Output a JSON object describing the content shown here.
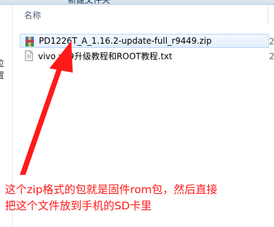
{
  "toolbar": {
    "fragment_left": "",
    "fragment_right": "新建文件夹"
  },
  "left_pane": {
    "partial_label": "位置"
  },
  "columns": {
    "name_label": "名称"
  },
  "files": [
    {
      "name": "PD1226T_A_1.16.2-update-full_r9449.zip",
      "icon": "winrar-archive-icon",
      "selected": true,
      "cut_value": "2"
    },
    {
      "name": "vivo y19升级教程和ROOT教程.txt",
      "icon": "text-file-icon",
      "selected": false,
      "cut_value": "2"
    }
  ],
  "annotation": {
    "line1": "这个zip格式的包就是固件rom包，然后直接",
    "line2": "把这个文件放到手机的SD卡里",
    "color": "#ff1a1a"
  }
}
